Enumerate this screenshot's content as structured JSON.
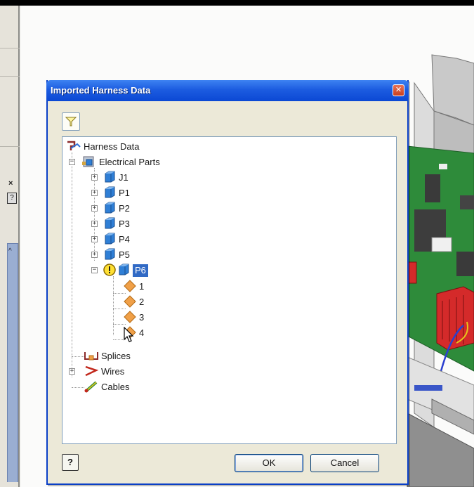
{
  "dialog": {
    "title": "Imported Harness Data",
    "close_icon": "close-icon",
    "filter_icon": "filter-icon",
    "ok_label": "OK",
    "cancel_label": "Cancel",
    "help_label": "?"
  },
  "tree": {
    "root": {
      "label": "Harness Data",
      "icon": "harness-icon"
    },
    "electrical_parts": {
      "label": "Electrical Parts",
      "icon": "electrical-parts-icon",
      "expanded": true
    },
    "parts": [
      {
        "label": "J1",
        "icon": "part-cube-icon",
        "expanded": false
      },
      {
        "label": "P1",
        "icon": "part-cube-icon",
        "expanded": false
      },
      {
        "label": "P2",
        "icon": "part-cube-icon",
        "expanded": false
      },
      {
        "label": "P3",
        "icon": "part-cube-icon",
        "expanded": false
      },
      {
        "label": "P4",
        "icon": "part-cube-icon",
        "expanded": false
      },
      {
        "label": "P5",
        "icon": "part-cube-icon",
        "expanded": false
      },
      {
        "label": "P6",
        "icon": "part-cube-icon",
        "expanded": true,
        "selected": true,
        "warning": true
      }
    ],
    "pins": [
      {
        "label": "1",
        "icon": "pin-icon"
      },
      {
        "label": "2",
        "icon": "pin-icon"
      },
      {
        "label": "3",
        "icon": "pin-icon"
      },
      {
        "label": "4",
        "icon": "pin-icon"
      }
    ],
    "splices": {
      "label": "Splices",
      "icon": "splice-icon"
    },
    "wires": {
      "label": "Wires",
      "icon": "wire-icon",
      "expanded": false
    },
    "cables": {
      "label": "Cables",
      "icon": "cable-icon"
    }
  },
  "colors": {
    "title_bar": "#0b48d4",
    "selection": "#316ac5",
    "dialog_bg": "#ece9d8",
    "cube_blue": "#2f7fd6",
    "pin_orange": "#f0a048",
    "board_green": "#2e8b3a",
    "connector_red": "#d42a2a"
  }
}
